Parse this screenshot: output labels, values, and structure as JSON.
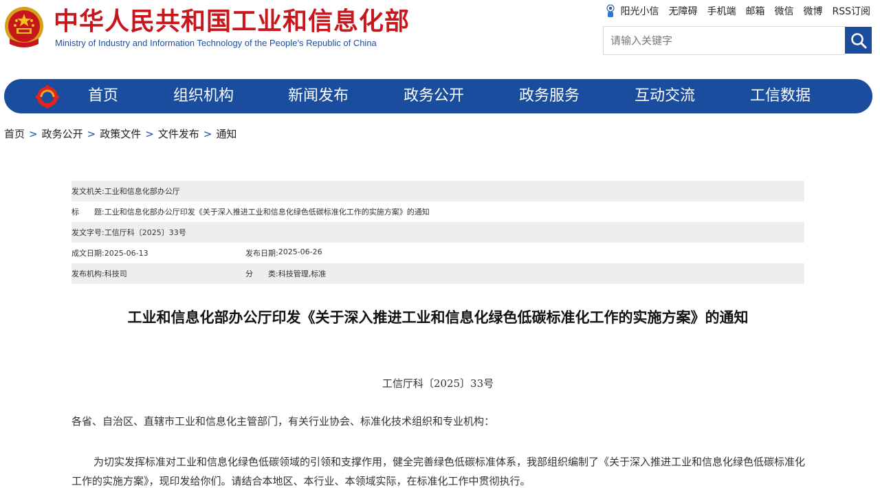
{
  "header": {
    "title": "中华人民共和国工业和信息化部",
    "subtitle": "Ministry of Industry and Information Technology of the People’s Republic of China",
    "emblem_icon": "national-emblem-icon",
    "brand_red": "#c8161d",
    "brand_blue": "#1a4d9e"
  },
  "toplinks": [
    "阳光小信",
    "无障碍",
    "手机端",
    "邮箱",
    "微信",
    "微博",
    "RSS订阅"
  ],
  "search": {
    "placeholder": "请输入关键字",
    "icon": "search-icon"
  },
  "nav": {
    "logo_icon": "miit-logo-icon",
    "items": [
      "首页",
      "组织机构",
      "新闻发布",
      "政务公开",
      "政务服务",
      "互动交流",
      "工信数据"
    ]
  },
  "breadcrumb": [
    "首页",
    "政务公开",
    "政策文件",
    "文件发布",
    "通知"
  ],
  "meta": {
    "issuer_label": "发文机关:",
    "issuer": "工业和信息化部办公厅",
    "title_label": "标　　题:",
    "title": "工业和信息化部办公厅印发《关于深入推进工业和信息化绿色低碳标准化工作的实施方案》的通知",
    "docno_label": "发文字号:",
    "docno": "工信厅科〔2025〕33号",
    "created_label": "成文日期:",
    "created": "2025-06-13",
    "published_label": "发布日期:",
    "published": "2025-06-26",
    "org_label": "发布机构:",
    "org": "科技司",
    "category_label": "分　　类:",
    "category": "科技管理,标准"
  },
  "article": {
    "title": "工业和信息化部办公厅印发《关于深入推进工业和信息化绿色低碳标准化工作的实施方案》的通知",
    "doc_number": "工信厅科〔2025〕33号",
    "addressee": "各省、自治区、直辖市工业和信息化主管部门，有关行业协会、标准化技术组织和专业机构：",
    "paragraph1": "为切实发挥标准对工业和信息化绿色低碳领域的引领和支撑作用，健全完善绿色低碳标准体系，我部组织编制了《关于深入推进工业和信息化绿色低碳标准化工作的实施方案》，现印发给你们。请结合本地区、本行业、本领域实际，在标准化工作中贯彻执行。"
  }
}
